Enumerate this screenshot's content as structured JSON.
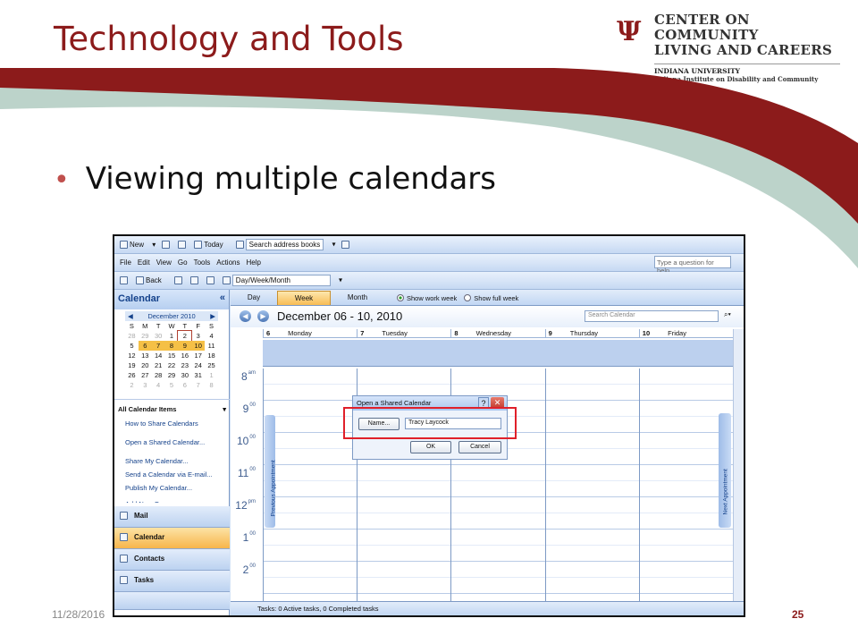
{
  "slide": {
    "title": "Technology and Tools",
    "bullet": "Viewing multiple calendars",
    "date": "11/28/2016",
    "page_number": "25",
    "accent_color": "#8c1b1b"
  },
  "logo": {
    "line1": "CENTER ON COMMUNITY",
    "line2": "LIVING AND CAREERS",
    "line3": "INDIANA UNIVERSITY",
    "line4": "Indiana Institute on Disability and Community"
  },
  "outlook": {
    "toolbar1": {
      "new": "New",
      "today": "Today",
      "search_books": "Search address books"
    },
    "menu": [
      "File",
      "Edit",
      "View",
      "Go",
      "Tools",
      "Actions",
      "Help"
    ],
    "help_placeholder": "Type a question for help",
    "toolbar3": {
      "back": "Back",
      "view_combo": "Day/Week/Month"
    },
    "nav": {
      "title": "Calendar",
      "mini_month": "December 2010",
      "weekdays": [
        "S",
        "M",
        "T",
        "W",
        "T",
        "F",
        "S"
      ],
      "weeks": [
        [
          "28",
          "29",
          "30",
          "1",
          "2",
          "3",
          "4"
        ],
        [
          "5",
          "6",
          "7",
          "8",
          "9",
          "10",
          "11"
        ],
        [
          "12",
          "13",
          "14",
          "15",
          "16",
          "17",
          "18"
        ],
        [
          "19",
          "20",
          "21",
          "22",
          "23",
          "24",
          "25"
        ],
        [
          "26",
          "27",
          "28",
          "29",
          "30",
          "31",
          "1"
        ],
        [
          "2",
          "3",
          "4",
          "5",
          "6",
          "7",
          "8"
        ]
      ],
      "section": "All Calendar Items",
      "links": [
        "How to Share Calendars",
        "Open a Shared Calendar...",
        "Share My Calendar...",
        "Send a Calendar via E-mail...",
        "Publish My Calendar...",
        "Add New Group"
      ],
      "buttons": [
        "Mail",
        "Calendar",
        "Contacts",
        "Tasks"
      ]
    },
    "calendar": {
      "tabs": [
        "Day",
        "Week",
        "Month"
      ],
      "show_work_week": "Show work week",
      "show_full_week": "Show full week",
      "date_range": "December 06 - 10, 2010",
      "search_placeholder": "Search Calendar",
      "days": [
        {
          "num": "6",
          "name": "Monday"
        },
        {
          "num": "7",
          "name": "Tuesday"
        },
        {
          "num": "8",
          "name": "Wednesday"
        },
        {
          "num": "9",
          "name": "Thursday"
        },
        {
          "num": "10",
          "name": "Friday"
        }
      ],
      "hours": [
        {
          "h": "8",
          "s": "am"
        },
        {
          "h": "9",
          "s": "00"
        },
        {
          "h": "10",
          "s": "00"
        },
        {
          "h": "11",
          "s": "00"
        },
        {
          "h": "12",
          "s": "pm"
        },
        {
          "h": "1",
          "s": "00"
        },
        {
          "h": "2",
          "s": "00"
        }
      ],
      "previous_appointment": "Previous Appointment",
      "next_appointment": "Next Appointment",
      "tasks_status": "Tasks: 0 Active tasks, 0 Completed tasks"
    },
    "dialog": {
      "title": "Open a Shared Calendar",
      "help": "?",
      "close": "✕",
      "name_button": "Name...",
      "name_value": "Tracy Laycock",
      "ok": "OK",
      "cancel": "Cancel"
    }
  }
}
